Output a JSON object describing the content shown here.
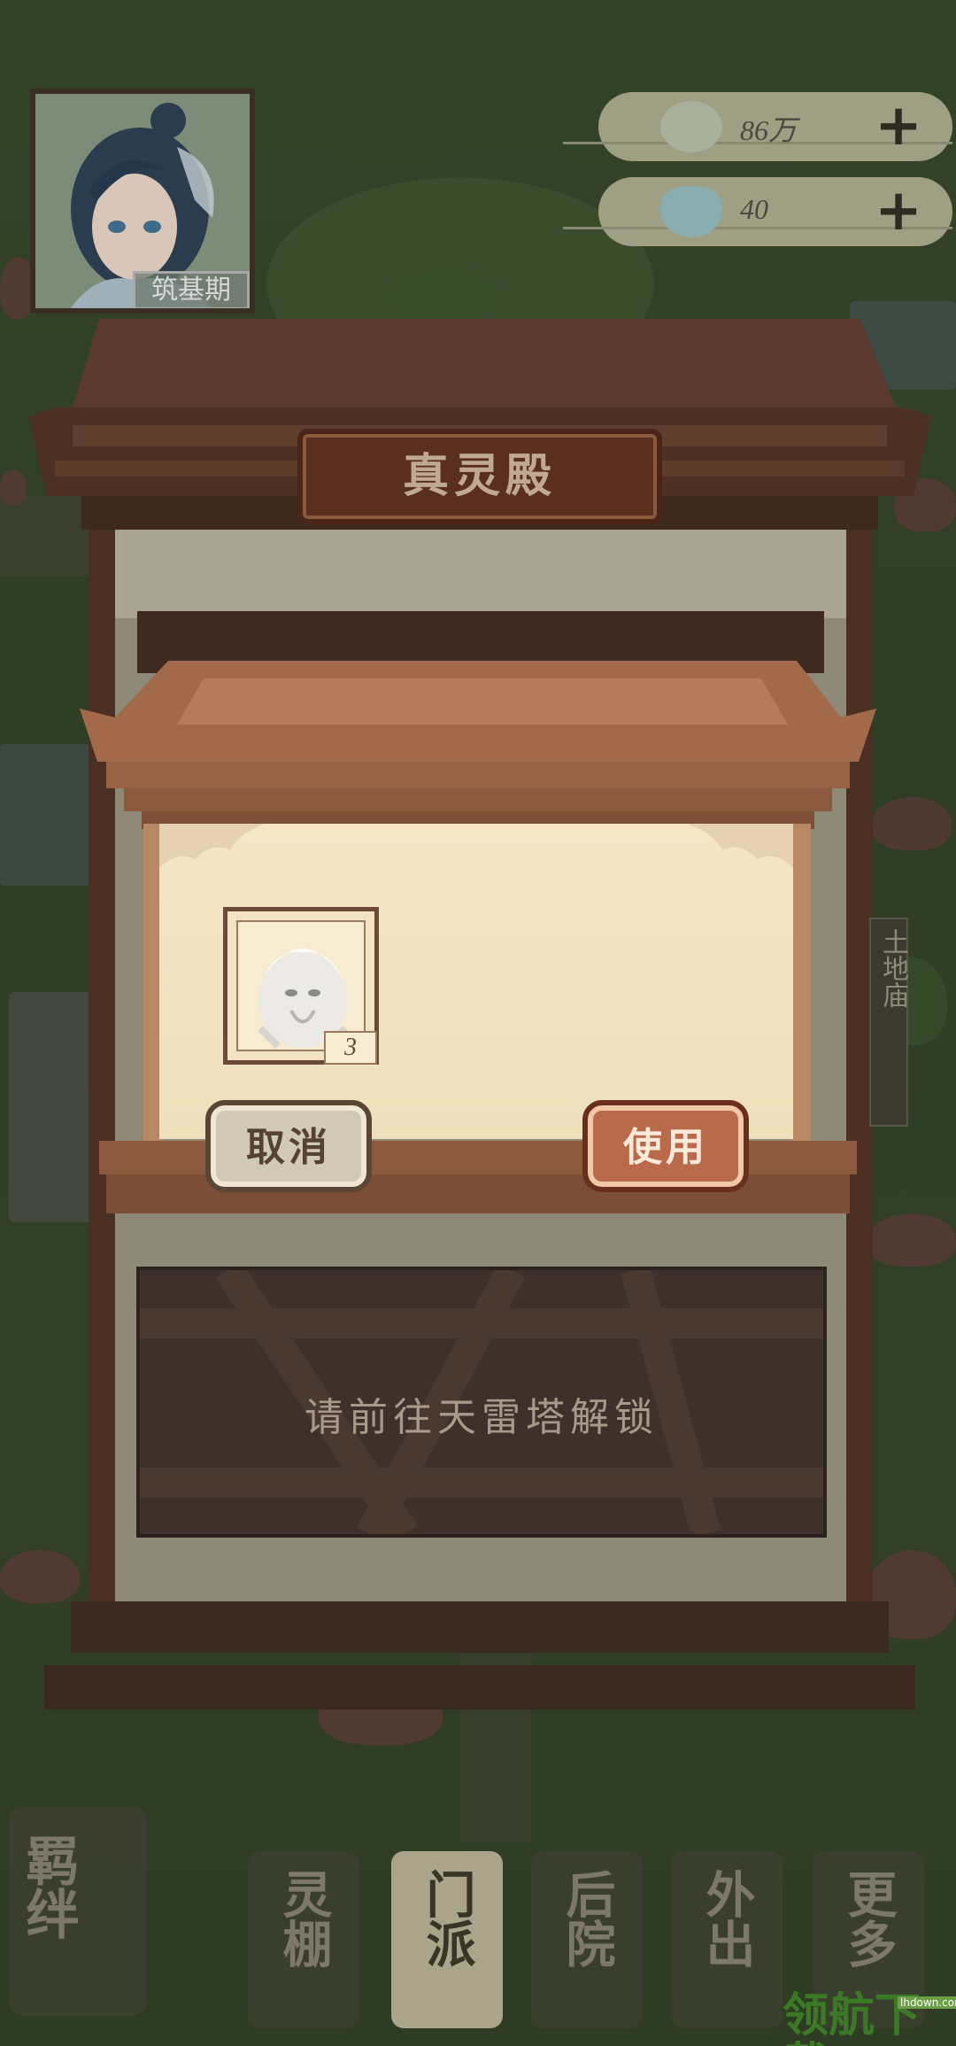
{
  "player": {
    "name_tag": "筑基期"
  },
  "currencies": [
    {
      "icon": "spirit-stone-icon",
      "value": "86万"
    },
    {
      "icon": "spirit-gem-icon",
      "value": "40"
    }
  ],
  "hall": {
    "title": "真灵殿",
    "item_slot": {
      "icon": "white-spirit-beast-icon",
      "count": "3"
    },
    "cancel_label": "取消",
    "use_label": "使用",
    "locked_message": "请前往天雷塔解锁"
  },
  "side_sign": "土地庙",
  "bottom_nav": {
    "left_tab": "羁绊",
    "tabs": [
      {
        "label": "灵棚",
        "active": false
      },
      {
        "label": "门派",
        "active": true
      },
      {
        "label": "后院",
        "active": false
      },
      {
        "label": "外出",
        "active": false
      },
      {
        "label": "更多",
        "active": false
      }
    ]
  },
  "watermark": {
    "text": "领航下载",
    "sub": "lhdown.com"
  },
  "colors": {
    "accent_use": "#b96a4a",
    "panel_bg": "#f4e7c6",
    "wood_dark": "#4a2f22"
  }
}
